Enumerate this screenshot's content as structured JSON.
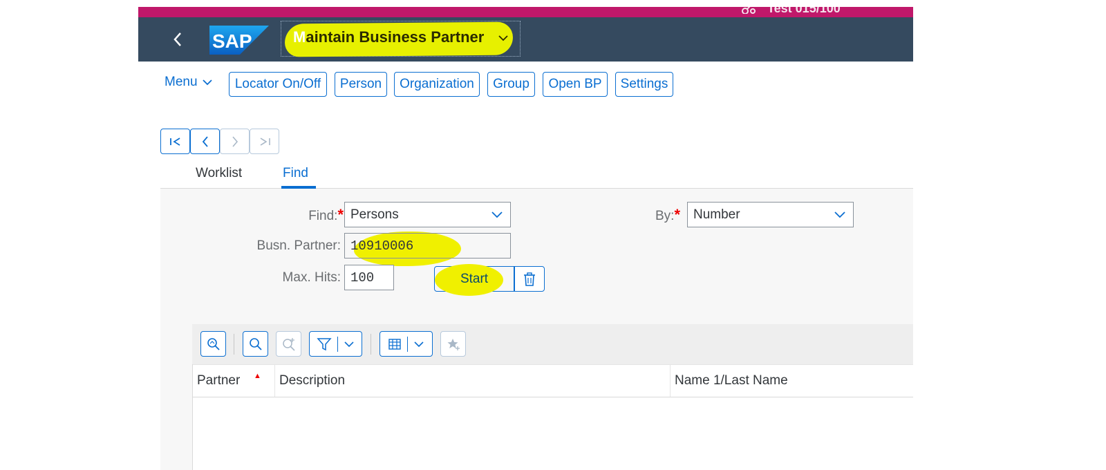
{
  "system": {
    "text": "Test 015/100"
  },
  "shell": {
    "title_first": "M",
    "title_rest": "aintain Business Partner"
  },
  "toolbar": {
    "menu_label": "Menu",
    "buttons": [
      "Locator On/Off",
      "Person",
      "Organization",
      "Group",
      "Open BP",
      "Settings"
    ]
  },
  "tabs": {
    "worklist": "Worklist",
    "find": "Find"
  },
  "form": {
    "find_label": "Find:",
    "find_value": "Persons",
    "by_label": "By:",
    "by_value": "Number",
    "busn_partner_label": "Busn. Partner:",
    "busn_partner_value": "10910006",
    "max_hits_label": "Max. Hits:",
    "max_hits_value": "100",
    "start_label": "Start"
  },
  "table": {
    "columns": [
      "Partner",
      "Description",
      "Name 1/Last Name"
    ]
  },
  "colors": {
    "accent": "#0a6ed1",
    "shell": "#354a5f",
    "top_strip": "#c0186a",
    "highlight": "#f0f000"
  }
}
